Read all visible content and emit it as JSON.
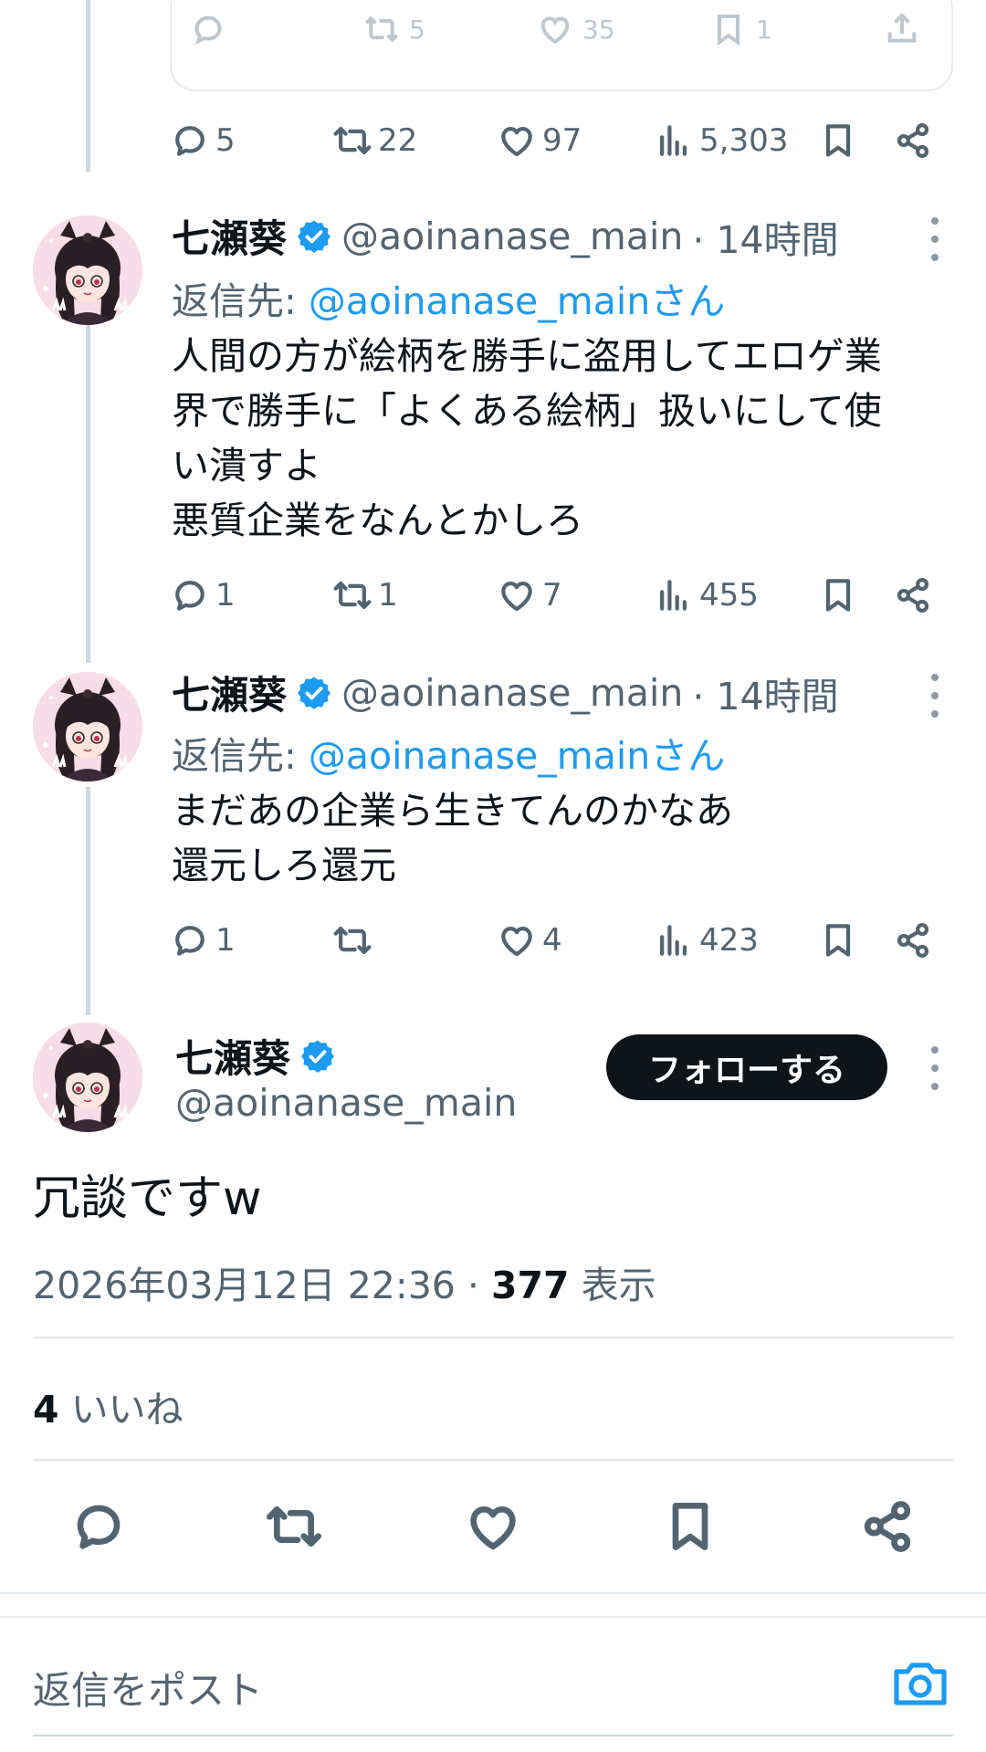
{
  "quoted_card": {
    "reply_count": "",
    "retweet_count": "5",
    "like_count": "35",
    "bookmark_count": "1"
  },
  "tweet0_actions": {
    "reply": "5",
    "retweet": "22",
    "like": "97",
    "views": "5,303"
  },
  "tweets": [
    {
      "name": "七瀬葵",
      "handle": "@aoinanase_main",
      "time": "· 14時間",
      "replying_prefix": "返信先: ",
      "replying_to": "@aoinanase_mainさん",
      "text": "人間の方が絵柄を勝手に盗用してエロゲ業\n界で勝手に「よくある絵柄」扱いにして使\nい潰すよ\n悪質企業をなんとかしろ",
      "reply": "1",
      "retweet": "1",
      "like": "7",
      "views": "455"
    },
    {
      "name": "七瀬葵",
      "handle": "@aoinanase_main",
      "time": "· 14時間",
      "replying_prefix": "返信先: ",
      "replying_to": "@aoinanase_mainさん",
      "text": "まだあの企業ら生きてんのかなあ\n還元しろ還元",
      "reply": "1",
      "retweet": "",
      "like": "4",
      "views": "423"
    }
  ],
  "main_tweet": {
    "name": "七瀬葵",
    "handle": "@aoinanase_main",
    "follow_label": "フォローする",
    "text": "冗談ですw",
    "datetime": "2026年03月12日 22:36 · ",
    "views_count": "377",
    "views_label": " 表示",
    "likes_count": "4",
    "likes_label": " いいね"
  },
  "reply_bar": {
    "placeholder": "返信をポスト"
  },
  "icons": [
    "reply-icon",
    "retweet-icon",
    "like-icon",
    "views-icon",
    "bookmark-icon",
    "share-icon",
    "upload-icon",
    "verified-badge-icon",
    "camera-icon",
    "more-icon"
  ],
  "colors": {
    "accent": "#1d9bf0",
    "text": "#0f1419",
    "secondary": "#536471",
    "follow_button": "#0f1419",
    "thread_line": "#cfd9de"
  }
}
